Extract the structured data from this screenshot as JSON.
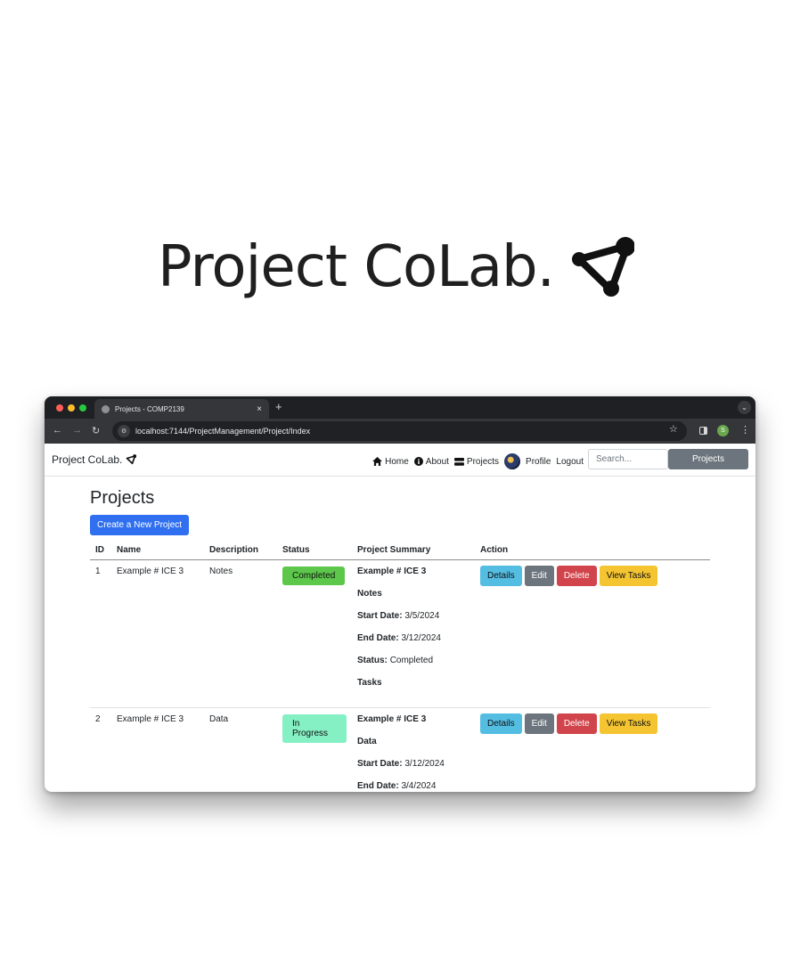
{
  "hero": {
    "title": "Project CoLab."
  },
  "browser": {
    "tab_title": "Projects - COMP2139",
    "tab_close": "×",
    "new_tab": "+",
    "url": "localhost:7144/ProjectManagement/Project/Index",
    "profile_initial": "S"
  },
  "navbar": {
    "brand": "Project CoLab.",
    "links": {
      "home": "Home",
      "about": "About",
      "projects": "Projects",
      "profile": "Profile",
      "logout": "Logout"
    },
    "search_placeholder": "Search...",
    "search_button": "Projects"
  },
  "page": {
    "title": "Projects",
    "create_button": "Create a New Project"
  },
  "table": {
    "headers": {
      "id": "ID",
      "name": "Name",
      "description": "Description",
      "status": "Status",
      "summary": "Project Summary",
      "action": "Action"
    },
    "rows": [
      {
        "id": "1",
        "name": "Example # ICE 3",
        "description": "Notes",
        "status": "Completed",
        "summary": {
          "name": "Example # ICE 3",
          "description": "Notes",
          "start_label": "Start Date:",
          "start_value": "3/5/2024",
          "end_label": "End Date:",
          "end_value": "3/12/2024",
          "status_label": "Status:",
          "status_value": "Completed",
          "tasks_label": "Tasks"
        }
      },
      {
        "id": "2",
        "name": "Example # ICE 3",
        "description": "Data",
        "status": "In Progress",
        "summary": {
          "name": "Example # ICE 3",
          "description": "Data",
          "start_label": "Start Date:",
          "start_value": "3/12/2024",
          "end_label": "End Date:",
          "end_value": "3/4/2024"
        }
      }
    ],
    "actions": {
      "details": "Details",
      "edit": "Edit",
      "delete": "Delete",
      "view_tasks": "View Tasks"
    }
  },
  "colors": {
    "primary": "#2f6ff0",
    "completed": "#5cc74a",
    "in_progress": "#85f0c4",
    "details": "#54bde2",
    "edit": "#6c757d",
    "delete": "#d2444c",
    "view_tasks": "#f4c531"
  }
}
